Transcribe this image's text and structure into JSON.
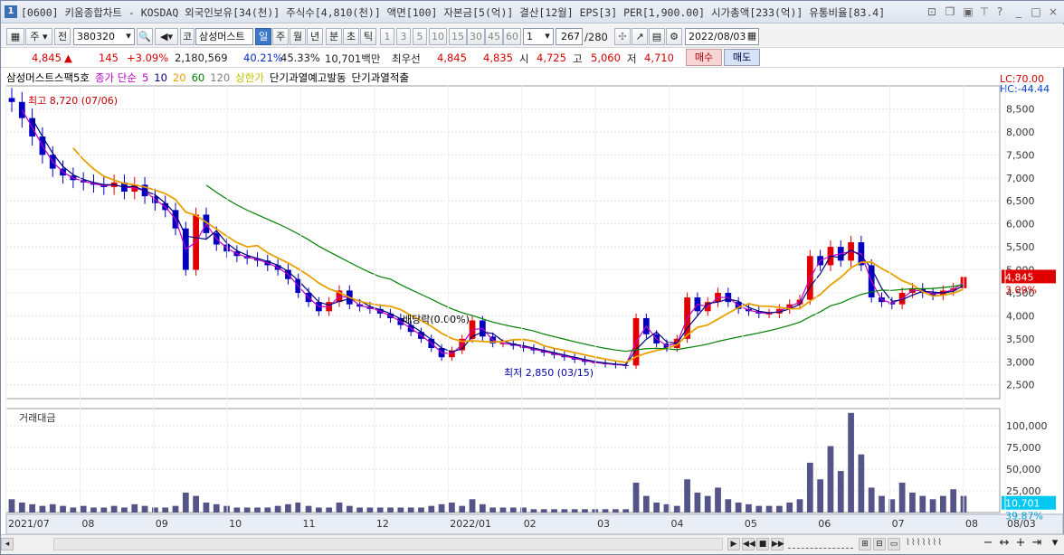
{
  "title": {
    "icon": "1",
    "text": "[0600] 키움종합차트 - KOSDAQ 외국인보유[34(천)] 주식수[4,810(천)] 액면[100] 자본금[5(억)] 결산[12월] EPS[3] PER[1,900.00] 시가총액[233(억)] 유통비율[83.4]"
  },
  "toolbar": {
    "jong": "주",
    "jeon": "전",
    "code": "380320",
    "ko": "코",
    "name": "삼성머스트",
    "periods": [
      "일",
      "주",
      "월",
      "년",
      "분",
      "초",
      "틱"
    ],
    "numbers": [
      "1",
      "3",
      "5",
      "10",
      "15",
      "30",
      "45",
      "60"
    ],
    "count_value": "1",
    "counter": "267",
    "counter_total": "/280",
    "date": "2022/08/03"
  },
  "quote": {
    "price": "4,845",
    "arrow": "▲",
    "change": "145",
    "pct": "+3.09%",
    "volume": "2,180,569",
    "ratio": "40.21%",
    "ratio2": "45.33%",
    "amount": "10,701백만",
    "best_label": "최우선",
    "best1": "4,845",
    "best2": "4,835",
    "open_label": "시",
    "open": "4,725",
    "high_label": "고",
    "high": "5,060",
    "low_label": "저",
    "low": "4,710",
    "buy": "매수",
    "sell": "매도"
  },
  "legend": [
    {
      "text": "삼성머스트스팩5호",
      "color": "#000000"
    },
    {
      "text": "종가 단순",
      "color": "#c000c0"
    },
    {
      "text": "5",
      "color": "#c000c0"
    },
    {
      "text": "10",
      "color": "#000080"
    },
    {
      "text": "20",
      "color": "#e8a000"
    },
    {
      "text": "60",
      "color": "#008000"
    },
    {
      "text": "120",
      "color": "#808080"
    },
    {
      "text": "상한가",
      "color": "#c0c000"
    },
    {
      "text": "단기과열예고발동",
      "color": "#000000"
    },
    {
      "text": "단기과열적출",
      "color": "#000000"
    }
  ],
  "chart_data": {
    "type": "candlestick",
    "y_ticks": [
      "8,500",
      "8,000",
      "7,500",
      "7,000",
      "6,500",
      "6,000",
      "5,500",
      "5,000",
      "4,500",
      "4,000",
      "3,500",
      "3,000",
      "2,500"
    ],
    "ylim": [
      2200,
      9000
    ],
    "lc_label": "LC:70.00",
    "hc_label": "HC:-44.44",
    "current_price": "4,845",
    "current_pct": "3.09%",
    "x_labels": [
      "2021/07",
      "08",
      "09",
      "10",
      "11",
      "12",
      "2022/01",
      "02",
      "03",
      "04",
      "05",
      "06",
      "07",
      "08",
      "08/03"
    ],
    "close": [
      8650,
      8300,
      7900,
      7500,
      7200,
      7050,
      6950,
      6900,
      6850,
      6800,
      6900,
      6700,
      6850,
      6600,
      6450,
      6300,
      5900,
      5000,
      6200,
      5800,
      5550,
      5400,
      5300,
      5250,
      5200,
      5100,
      5000,
      4800,
      4500,
      4300,
      4100,
      4300,
      4550,
      4250,
      4200,
      4150,
      4050,
      3950,
      3800,
      3650,
      3500,
      3300,
      3100,
      3250,
      3500,
      3900,
      3550,
      3400,
      3400,
      3350,
      3300,
      3250,
      3200,
      3150,
      3100,
      3050,
      3000,
      2970,
      2950,
      2930,
      2920,
      3950,
      3600,
      3400,
      3300,
      3500,
      4400,
      4100,
      4300,
      4500,
      4300,
      4150,
      4100,
      4050,
      4050,
      4150,
      4250,
      4350,
      5300,
      5100,
      5500,
      5200,
      5600,
      5100,
      4400,
      4300,
      4250,
      4500,
      4600,
      4500,
      4450,
      4550,
      4600,
      4845
    ],
    "annotations": {
      "high": "최고 8,720 (07/06)",
      "low": "최저 2,850 (03/15)",
      "drop": "배당락(0.00%)"
    },
    "volume_label": "거래대금",
    "volume_ticks": [
      "100,000",
      "75,000",
      "50,000",
      "25,000"
    ],
    "volume_current": "10,701",
    "volume_pct": "39.87%",
    "volume": [
      8,
      6,
      5,
      4,
      5,
      4,
      3,
      4,
      3,
      3,
      4,
      3,
      5,
      4,
      3,
      3,
      4,
      12,
      10,
      6,
      5,
      4,
      3,
      3,
      3,
      3,
      4,
      5,
      6,
      4,
      3,
      3,
      6,
      4,
      3,
      3,
      3,
      3,
      3,
      3,
      3,
      4,
      5,
      6,
      4,
      8,
      5,
      3,
      3,
      3,
      3,
      2,
      2,
      2,
      2,
      2,
      2,
      2,
      2,
      2,
      2,
      18,
      10,
      6,
      5,
      4,
      20,
      12,
      10,
      15,
      8,
      6,
      5,
      4,
      4,
      4,
      6,
      8,
      30,
      20,
      40,
      25,
      60,
      35,
      15,
      10,
      8,
      18,
      12,
      10,
      8,
      10,
      14,
      10
    ]
  }
}
